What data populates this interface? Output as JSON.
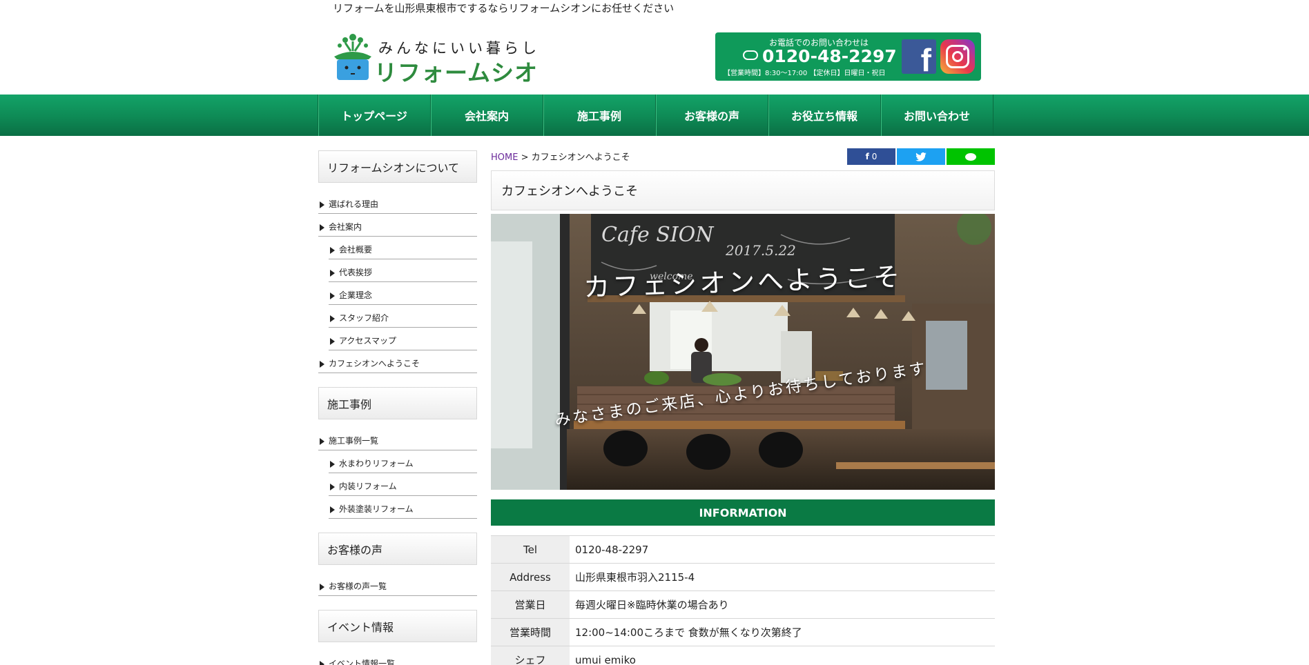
{
  "header": {
    "tagline": "リフォームを山形県東根市でするならリフォームシオンにお任せください",
    "logo_sub": "みんなにいい暮らし",
    "logo_main": "リフォームシオン",
    "contact_label": "お電話でのお問い合わせは",
    "contact_phone": "0120-48-2297",
    "contact_hours": "【営業時間】8:30～17:00 【定休日】日曜日・祝日",
    "facebook_icon": "facebook-icon",
    "instagram_icon": "instagram-icon"
  },
  "nav": {
    "items": [
      "トップページ",
      "会社案内",
      "施工事例",
      "お客様の声",
      "お役立ち情報",
      "お問い合わせ"
    ]
  },
  "sidebar": {
    "sections": [
      {
        "heading": "リフォームシオンについて",
        "items": [
          {
            "label": "選ばれる理由",
            "sub": false
          },
          {
            "label": "会社案内",
            "sub": false
          },
          {
            "label": "会社概要",
            "sub": true
          },
          {
            "label": "代表挨拶",
            "sub": true
          },
          {
            "label": "企業理念",
            "sub": true
          },
          {
            "label": "スタッフ紹介",
            "sub": true
          },
          {
            "label": "アクセスマップ",
            "sub": true
          },
          {
            "label": "カフェシオンへようこそ",
            "sub": false
          }
        ]
      },
      {
        "heading": "施工事例",
        "items": [
          {
            "label": "施工事例一覧",
            "sub": false
          },
          {
            "label": "水まわりリフォーム",
            "sub": true
          },
          {
            "label": "内装リフォーム",
            "sub": true
          },
          {
            "label": "外装塗装リフォーム",
            "sub": true
          }
        ]
      },
      {
        "heading": "お客様の声",
        "items": [
          {
            "label": "お客様の声一覧",
            "sub": false
          }
        ]
      },
      {
        "heading": "イベント情報",
        "items": [
          {
            "label": "イベント情報一覧",
            "sub": false
          }
        ]
      }
    ]
  },
  "main": {
    "breadcrumb_home": "HOME",
    "breadcrumb_sep": ">",
    "breadcrumb_current": "カフェシオンへようこそ",
    "share_fb_count": "0",
    "page_title": "カフェシオンへようこそ",
    "hero_title": "カフェシオンへようこそ",
    "hero_subtitle": "みなさまのご来店、心よりお待ちしております",
    "chalkboard_cafe": "Cafe SION",
    "chalkboard_date": "2017.5.22",
    "chalkboard_welcome": "welcome",
    "info_heading": "INFORMATION",
    "info_rows": [
      {
        "label": "Tel",
        "value": "0120-48-2297"
      },
      {
        "label": "Address",
        "value": "山形県東根市羽入2115-4"
      },
      {
        "label": "営業日",
        "value": "毎週火曜日※臨時休業の場合あり"
      },
      {
        "label": "営業時間",
        "value": "12:00~14:00ころまで 食数が無くなり次第終了"
      },
      {
        "label": "シェフ",
        "value": "umui emiko"
      }
    ]
  },
  "colors": {
    "brand_green": "#0f9a5a",
    "nav_green": "#0e8a55",
    "info_green": "#0a7a44",
    "logo_green": "#2e8b3e"
  }
}
